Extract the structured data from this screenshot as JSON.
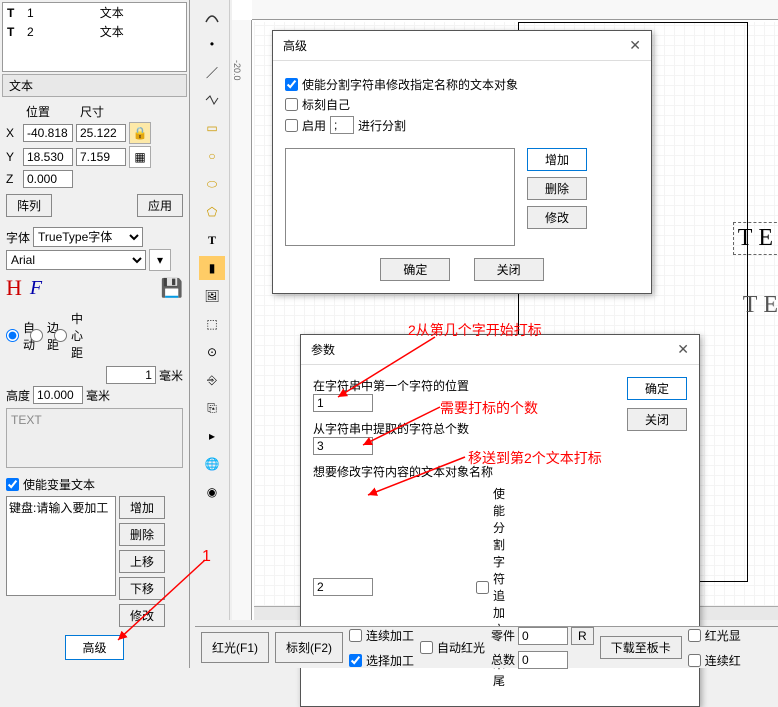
{
  "objList": [
    {
      "icon": "T",
      "idx": "1",
      "type": "文本"
    },
    {
      "icon": "T",
      "idx": "2",
      "type": "文本"
    }
  ],
  "panelTitle": "文本",
  "pos": {
    "hdr_pos": "位置",
    "hdr_size": "尺寸",
    "x": "-40.818",
    "y": "18.530",
    "z": "0.000",
    "w": "25.122",
    "h": "7.159"
  },
  "btns": {
    "array": "阵列",
    "apply": "应用",
    "advanced": "高级",
    "add": "增加",
    "del": "删除",
    "up": "上移",
    "down": "下移",
    "mod": "修改"
  },
  "font": {
    "label": "字体",
    "type": "TrueType字体",
    "name": "Arial"
  },
  "mode": {
    "auto": "自动",
    "margin": "边距",
    "center": "中心距",
    "val": "1",
    "unit": "毫米"
  },
  "height": {
    "label": "高度",
    "val": "10.000",
    "unit": "毫米"
  },
  "sample": "TEXT",
  "varText": {
    "chk": "使能变量文本",
    "keyboard": "键盘:请输入要加工"
  },
  "dlg1": {
    "title": "高级",
    "chk1": "使能分割字符串修改指定名称的文本对象",
    "chk2": "标刻自己",
    "chk3": "启用",
    "sep": ";",
    "chk3b": "进行分割",
    "add": "增加",
    "del": "删除",
    "mod": "修改",
    "ok": "确定",
    "close": "关闭"
  },
  "dlg2": {
    "title": "参数",
    "l1": "在字符串中第一个字符的位置",
    "v1": "1",
    "l2": "从字符串中提取的字符总个数",
    "v2": "3",
    "l3": "想要修改字符内容的文本对象名称",
    "v3": "2",
    "chk": "使能分割字符追加文本末尾",
    "ok": "确定",
    "close": "关闭"
  },
  "annots": {
    "a1": "1",
    "a2": "2从第几个字开始打标",
    "a3": "需要打标的个数",
    "a4": "移送到第2个文本打标"
  },
  "canvasText": "TEXT",
  "bottom": {
    "red": "红光(F1)",
    "mark": "标刻(F2)",
    "cont": "连续加工",
    "autored": "自动红光",
    "parts": "零件",
    "partsval": "0",
    "r": "R",
    "download": "下载至板卡",
    "redlight": "红光显",
    "sel": "选择加工",
    "total": "总数",
    "totalval": "0",
    "continue": "连续红"
  }
}
